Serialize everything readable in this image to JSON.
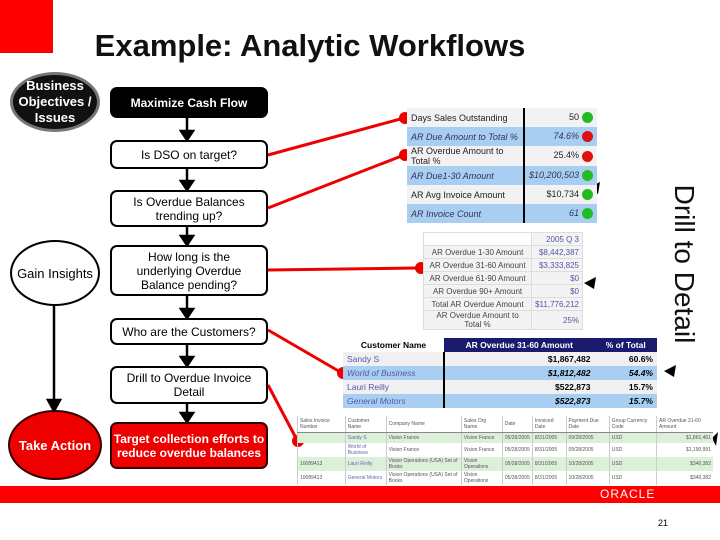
{
  "title": "Example:  Analytic Workflows",
  "left_labels": {
    "objectives": "Business Objectives / Issues",
    "insights": "Gain Insights",
    "action": "Take Action"
  },
  "flow": {
    "step1": "Maximize Cash Flow",
    "step2": "Is DSO on target?",
    "step3": "Is Overdue Balances trending up?",
    "step4": "How long is the underlying Overdue Balance pending?",
    "step5": "Who are the Customers?",
    "step6": "Drill to Overdue Invoice Detail",
    "step7": "Target collection efforts to reduce overdue balances"
  },
  "drill_label": "Drill to Detail",
  "colors": {
    "accent_red": "#e00000",
    "green_status": "#22bb22",
    "red_status": "#dd1111",
    "row_blue": "#a8cff2"
  },
  "kpi_rows": [
    {
      "label": "Days Sales Outstanding",
      "value": "50",
      "status": "green"
    },
    {
      "label": "AR Due Amount to Total %",
      "value": "74.6%",
      "status": "red"
    },
    {
      "label": "AR Overdue Amount to Total %",
      "value": "25.4%",
      "status": "red"
    },
    {
      "label": "AR Due1-30 Amount",
      "value": "$10,200,503",
      "status": "green"
    },
    {
      "label": "AR Avg Invoice Amount",
      "value": "$10,734",
      "status": "green"
    },
    {
      "label": "AR Invoice Count",
      "value": "61",
      "status": "green"
    }
  ],
  "overdue": {
    "period": "2005 Q 3",
    "rows": [
      {
        "label": "AR Overdue 1-30 Amount",
        "value": "$8,442,387"
      },
      {
        "label": "AR Overdue 31-60 Amount",
        "value": "$3,333,825"
      },
      {
        "label": "AR Overdue 61-90 Amount",
        "value": "$0"
      },
      {
        "label": "AR Overdue 90+ Amount",
        "value": "$0"
      },
      {
        "label": "Total AR Overdue Amount",
        "value": "$11,776,212"
      },
      {
        "label": "AR Overdue Amount to Total %",
        "value": "25%"
      }
    ]
  },
  "customers": {
    "headers": [
      "Customer Name",
      "AR Overdue 31-60 Amount",
      "% of Total"
    ],
    "rows": [
      [
        "Sandy S",
        "$1,867,482",
        "60.6%"
      ],
      [
        "World of Business",
        "$1,812,482",
        "54.4%"
      ],
      [
        "Lauri Reilly",
        "$522,873",
        "15.7%"
      ],
      [
        "General Motors",
        "$522,873",
        "15.7%"
      ]
    ]
  },
  "invoices": {
    "headers": [
      "Sales Invoice Number",
      "Customer Name",
      "Company Name",
      "Sales Org Name",
      "Date",
      "Invoiced Date",
      "Payment Due Date",
      "Group Currency Code",
      "AR Overdue 31-60 Amount"
    ],
    "rows": [
      [
        "",
        "Sandy S",
        "Vision France",
        "Vision France",
        "05/28/2005",
        "8/31/2005",
        "09/28/2005",
        "USD",
        "$1,861,461"
      ],
      [
        "",
        "World of Business",
        "Vision France",
        "Vision France",
        "05/28/2005",
        "8/31/2005",
        "09/28/2005",
        "USD",
        "$1,190,991"
      ],
      [
        "10089413",
        "Lauri Reilly",
        "Vision Operations (USA) Set of Books",
        "Vision Operations",
        "05/28/2005",
        "8/31/2005",
        "10/28/2005",
        "USD",
        "$340,382"
      ],
      [
        "10089413",
        "General Motors",
        "Vision Operations (USA) Set of Books",
        "Vision Operations",
        "05/28/2005",
        "8/31/2005",
        "10/28/2005",
        "USD",
        "$340,382"
      ]
    ]
  },
  "footer": {
    "brand": "ORACLE",
    "page": "21"
  }
}
